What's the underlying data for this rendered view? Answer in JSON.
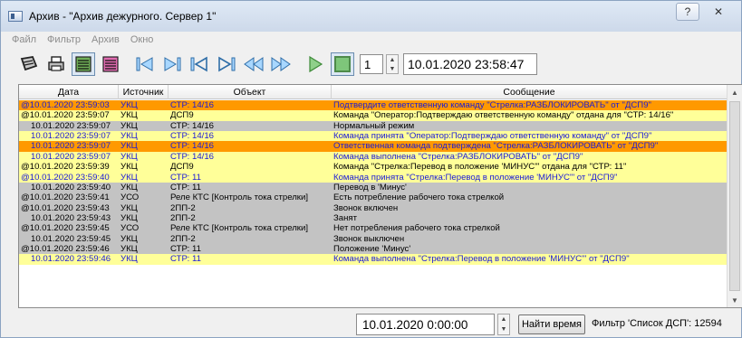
{
  "window": {
    "title": "Архив - \"Архив дежурного. Сервер 1\"",
    "help_glyph": "?",
    "close_glyph": "✕"
  },
  "menu": [
    "Файл",
    "Фильтр",
    "Архив",
    "Окно"
  ],
  "toolbar": {
    "count_value": "1",
    "datetime_value": "10.01.2020 23:58:47"
  },
  "table": {
    "columns": [
      "Дата",
      "Источник",
      "Объект",
      "Сообщение"
    ],
    "row_colors": {
      "orange": {
        "bg": "#ff9900",
        "fg_msg": "#2020d0"
      },
      "yellow": {
        "bg": "#ffff99",
        "fg_msg": "#1a1ad8"
      },
      "gray": {
        "bg": "#c3c3c3",
        "fg_msg": "#000000"
      }
    },
    "rows": [
      {
        "date": "@10.01.2020 23:59:03",
        "src": "УКЦ",
        "obj": "СТР: 14/16",
        "msg": "Подтвердите ответственную команду \"Стрелка:РАЗБЛОКИРОВАТЬ\" от \"ДСП9\"",
        "color": "orange",
        "text_color": "#1a1ad8"
      },
      {
        "date": "@10.01.2020 23:59:07",
        "src": "УКЦ",
        "obj": "ДСП9",
        "msg": "Команда \"Оператор:Подтверждаю ответственную команду\" отдана для \"СТР: 14/16\"",
        "color": "yellow",
        "text_color": "#000000"
      },
      {
        "date": "10.01.2020 23:59:07",
        "src": "УКЦ",
        "obj": "СТР: 14/16",
        "msg": "Нормальный режим",
        "color": "gray",
        "text_color": "#000000"
      },
      {
        "date": "10.01.2020 23:59:07",
        "src": "УКЦ",
        "obj": "СТР: 14/16",
        "msg": "Команда принята \"Оператор:Подтверждаю ответственную команду\" от \"ДСП9\"",
        "color": "yellow",
        "text_color": "#1a1ad8"
      },
      {
        "date": "10.01.2020 23:59:07",
        "src": "УКЦ",
        "obj": "СТР: 14/16",
        "msg": "Ответственная команда подтверждена \"Стрелка:РАЗБЛОКИРОВАТЬ\" от \"ДСП9\"",
        "color": "orange",
        "text_color": "#1a1ad8"
      },
      {
        "date": "10.01.2020 23:59:07",
        "src": "УКЦ",
        "obj": "СТР: 14/16",
        "msg": "Команда выполнена \"Стрелка:РАЗБЛОКИРОВАТЬ\" от \"ДСП9\"",
        "color": "yellow",
        "text_color": "#1a1ad8"
      },
      {
        "date": "@10.01.2020 23:59:39",
        "src": "УКЦ",
        "obj": "ДСП9",
        "msg": "Команда \"Стрелка:Перевод в положение 'МИНУС'\" отдана для \"СТР: 11\"",
        "color": "yellow",
        "text_color": "#000000"
      },
      {
        "date": "@10.01.2020 23:59:40",
        "src": "УКЦ",
        "obj": "СТР: 11",
        "msg": "Команда принята \"Стрелка:Перевод в положение 'МИНУС'\" от \"ДСП9\"",
        "color": "yellow",
        "text_color": "#1a1ad8"
      },
      {
        "date": "10.01.2020 23:59:40",
        "src": "УКЦ",
        "obj": "СТР: 11",
        "msg": "Перевод в 'Минус'",
        "color": "gray",
        "text_color": "#000000"
      },
      {
        "date": "@10.01.2020 23:59:41",
        "src": "УСО",
        "obj": "Реле КТС [Контроль тока стрелки]",
        "msg": "Есть потребление рабочего тока стрелкой",
        "color": "gray",
        "text_color": "#000000"
      },
      {
        "date": "@10.01.2020 23:59:43",
        "src": "УКЦ",
        "obj": "2ПП-2",
        "msg": "Звонок включен",
        "color": "gray",
        "text_color": "#000000"
      },
      {
        "date": "10.01.2020 23:59:43",
        "src": "УКЦ",
        "obj": "2ПП-2",
        "msg": "Занят",
        "color": "gray",
        "text_color": "#000000"
      },
      {
        "date": "@10.01.2020 23:59:45",
        "src": "УСО",
        "obj": "Реле КТС [Контроль тока стрелки]",
        "msg": "Нет потребления рабочего тока стрелкой",
        "color": "gray",
        "text_color": "#000000"
      },
      {
        "date": "10.01.2020 23:59:45",
        "src": "УКЦ",
        "obj": "2ПП-2",
        "msg": "Звонок выключен",
        "color": "gray",
        "text_color": "#000000"
      },
      {
        "date": "@10.01.2020 23:59:46",
        "src": "УКЦ",
        "obj": "СТР: 11",
        "msg": "Положение 'Минус'",
        "color": "gray",
        "text_color": "#000000"
      },
      {
        "date": "10.01.2020 23:59:46",
        "src": "УКЦ",
        "obj": "СТР: 11",
        "msg": "Команда выполнена \"Стрелка:Перевод в положение 'МИНУС'\" от \"ДСП9\"",
        "color": "yellow",
        "text_color": "#1a1ad8"
      }
    ]
  },
  "footer": {
    "find_date_value": "10.01.2020 0:00:00",
    "find_button": "Найти время",
    "filter_label": "Фильтр 'Список ДСП': 12594"
  }
}
